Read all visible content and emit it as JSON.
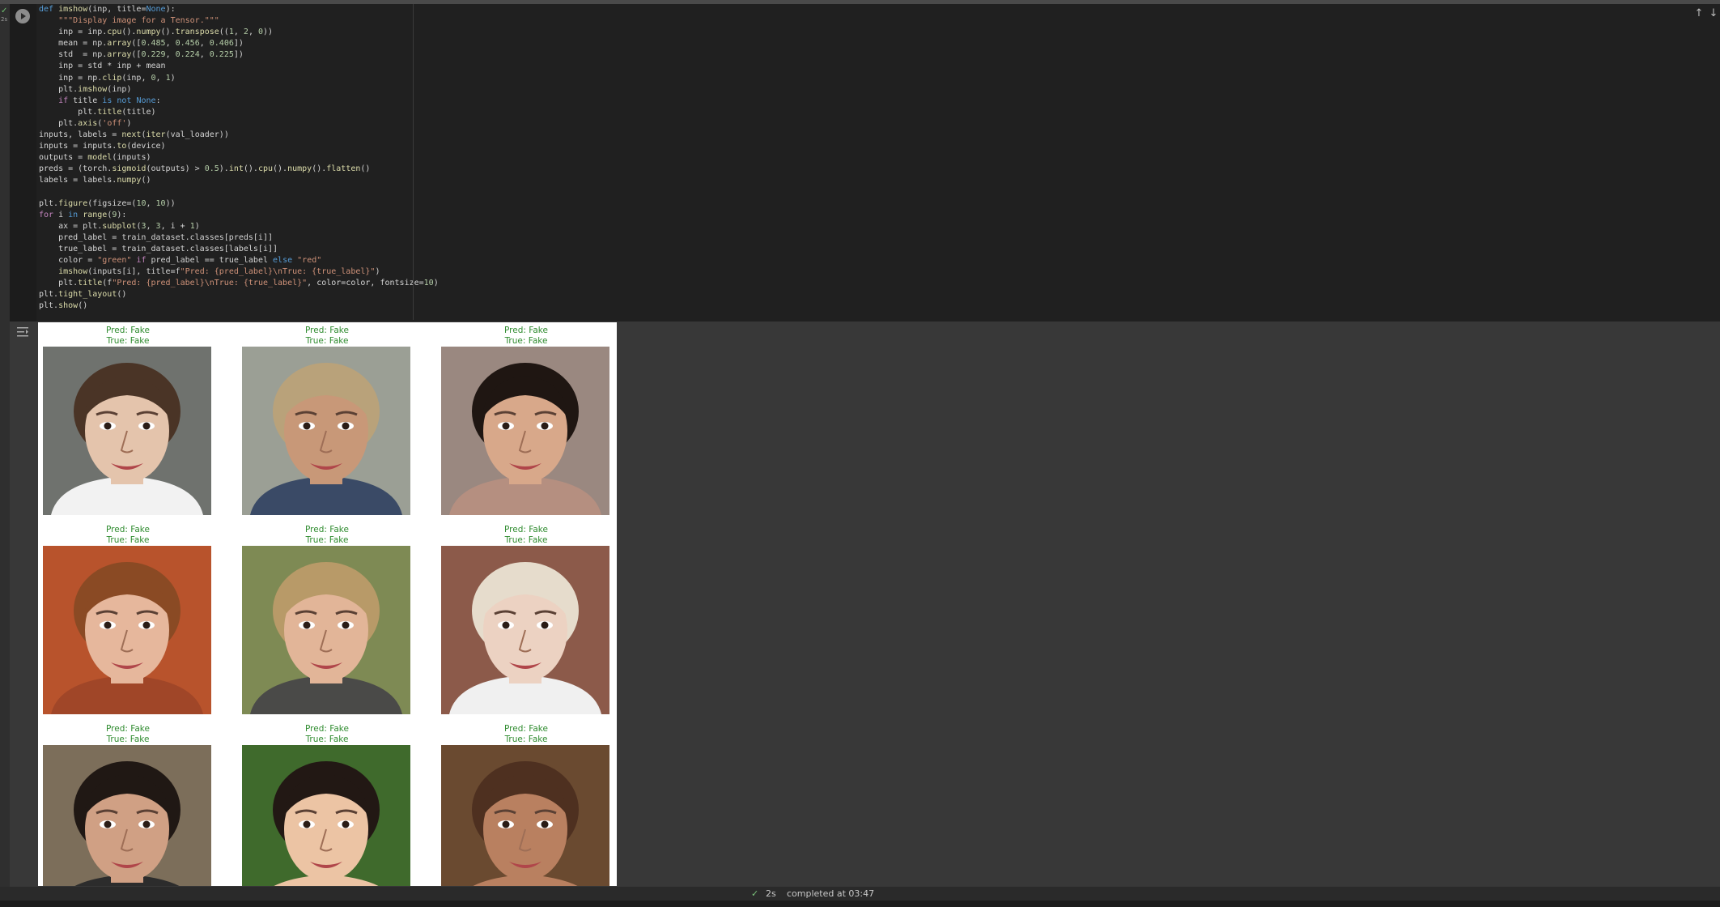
{
  "cell": {
    "status": {
      "check": "✓",
      "time": "2s"
    },
    "code_lines": [
      "def imshow(inp, title=None):",
      "    \"\"\"Display image for a Tensor.\"\"\"",
      "    inp = inp.cpu().numpy().transpose((1, 2, 0))",
      "    mean = np.array([0.485, 0.456, 0.406])",
      "    std  = np.array([0.229, 0.224, 0.225])",
      "    inp = std * inp + mean",
      "    inp = np.clip(inp, 0, 1)",
      "    plt.imshow(inp)",
      "    if title is not None:",
      "        plt.title(title)",
      "    plt.axis('off')",
      "inputs, labels = next(iter(val_loader))",
      "inputs = inputs.to(device)",
      "outputs = model(inputs)",
      "preds = (torch.sigmoid(outputs) > 0.5).int().cpu().numpy().flatten()",
      "labels = labels.numpy()",
      "",
      "plt.figure(figsize=(10, 10))",
      "for i in range(9):",
      "    ax = plt.subplot(3, 3, i + 1)",
      "    pred_label = train_dataset.classes[preds[i]]",
      "    true_label = train_dataset.classes[labels[i]]",
      "    color = \"green\" if pred_label == true_label else \"red\"",
      "    imshow(inputs[i], title=f\"Pred: {pred_label}\\nTrue: {true_label}\")",
      "    plt.title(f\"Pred: {pred_label}\\nTrue: {true_label}\", color=color, fontsize=10)",
      "plt.tight_layout()",
      "plt.show()"
    ]
  },
  "output": {
    "panels": [
      {
        "pred": "Pred: Fake",
        "true": "True: Fake",
        "face": "baby-face",
        "bg": "#6f726e",
        "skin": "#e4c4ac",
        "hair": "#4a3426",
        "shirt": "#f2f2f2"
      },
      {
        "pred": "Pred: Fake",
        "true": "True: Fake",
        "face": "curly-blond-face",
        "bg": "#9b9f95",
        "skin": "#c89878",
        "hair": "#b9a27a",
        "shirt": "#3a4a66"
      },
      {
        "pred": "Pred: Fake",
        "true": "True: Fake",
        "face": "smiling-woman-face",
        "bg": "#9a8880",
        "skin": "#d8a88a",
        "hair": "#1f1612",
        "shirt": "#b58f80"
      },
      {
        "pred": "Pred: Fake",
        "true": "True: Fake",
        "face": "laughing-woman-face",
        "bg": "#b8532c",
        "skin": "#e6b79c",
        "hair": "#8a4a24",
        "shirt": "#a04628"
      },
      {
        "pred": "Pred: Fake",
        "true": "True: Fake",
        "face": "blond-woman-face",
        "bg": "#7e8a54",
        "skin": "#e2b598",
        "hair": "#b89a68",
        "shirt": "#4a4a48"
      },
      {
        "pred": "Pred: Fake",
        "true": "True: Fake",
        "face": "toddler-face",
        "bg": "#8c5a4a",
        "skin": "#ecd2c2",
        "hair": "#e6dccc",
        "shirt": "#f0f0f0"
      },
      {
        "pred": "Pred: Fake",
        "true": "True: Fake",
        "face": "man-face",
        "bg": "#7c6e5a",
        "skin": "#d0a084",
        "hair": "#201814",
        "shirt": "#2c2c2c"
      },
      {
        "pred": "Pred: Fake",
        "true": "True: Fake",
        "face": "young-woman-face",
        "bg": "#3f6a2c",
        "skin": "#ecc4a4",
        "hair": "#221814",
        "shirt": "#ecc4a4"
      },
      {
        "pred": "Pred: Fake",
        "true": "True: Fake",
        "face": "curly-woman-face",
        "bg": "#6a4a30",
        "skin": "#b98060",
        "hair": "#4e3020",
        "shirt": "#b98060"
      }
    ]
  },
  "statusbar": {
    "check": "✓",
    "duration": "2s",
    "completed": "completed at 03:47"
  },
  "colors": {
    "keyword": "#569cd6",
    "control": "#c586c0",
    "string": "#ce9178",
    "number": "#b5cea8",
    "function": "#dcdcaa",
    "title_green": "#2e8b2e"
  }
}
